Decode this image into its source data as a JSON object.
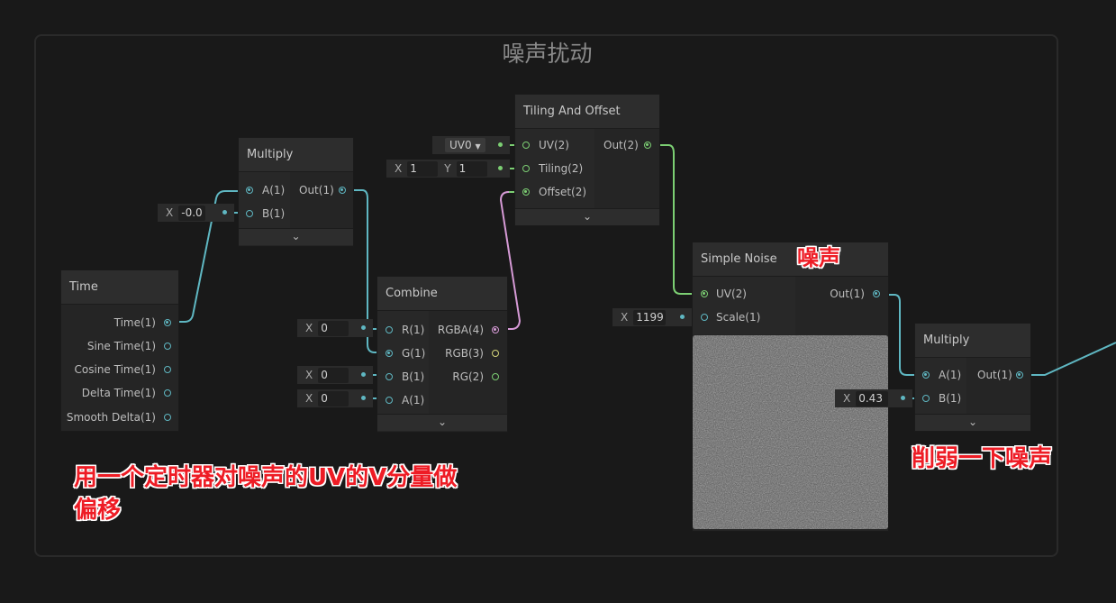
{
  "group": {
    "title": "噪声扰动"
  },
  "nodes": {
    "time": {
      "title": "Time",
      "outputs": [
        "Time(1)",
        "Sine Time(1)",
        "Cosine Time(1)",
        "Delta Time(1)",
        "Smooth Delta(1)"
      ]
    },
    "multiply1": {
      "title": "Multiply",
      "inputs": [
        "A(1)",
        "B(1)"
      ],
      "outputs": [
        "Out(1)"
      ],
      "b_field": {
        "label": "X",
        "value": "-0.0"
      }
    },
    "combine": {
      "title": "Combine",
      "inputs": [
        "R(1)",
        "G(1)",
        "B(1)",
        "A(1)"
      ],
      "outputs": [
        "RGBA(4)",
        "RGB(3)",
        "RG(2)"
      ],
      "fields": [
        {
          "label": "X",
          "value": "0"
        },
        {
          "label": "X",
          "value": "0"
        },
        {
          "label": "X",
          "value": "0"
        }
      ]
    },
    "tiling": {
      "title": "Tiling And Offset",
      "inputs": [
        "UV(2)",
        "Tiling(2)",
        "Offset(2)"
      ],
      "outputs": [
        "Out(2)"
      ],
      "uv_dropdown": "UV0",
      "tiling_field": {
        "x_label": "X",
        "x": "1",
        "y_label": "Y",
        "y": "1"
      }
    },
    "noise": {
      "title": "Simple Noise",
      "inputs": [
        "UV(2)",
        "Scale(1)"
      ],
      "outputs": [
        "Out(1)"
      ],
      "scale_field": {
        "label": "X",
        "value": "1199"
      }
    },
    "multiply2": {
      "title": "Multiply",
      "inputs": [
        "A(1)",
        "B(1)"
      ],
      "outputs": [
        "Out(1)"
      ],
      "b_field": {
        "label": "X",
        "value": "0.43"
      }
    }
  },
  "annotations": {
    "noise": "噪声",
    "timer_line1": "用一个定时器对噪声的UV的V分量做",
    "timer_line2": "偏移",
    "weaken": "削弱一下噪声"
  },
  "colors": {
    "float_wire": "#5fb7c2",
    "vec2_wire": "#7ccf73",
    "vec4_wire": "#d69ad6",
    "vec3_port": "#d3d37a",
    "annotation": "#ee1c25"
  },
  "icons": {
    "expand": "chevron-down-icon",
    "dropdown": "caret-down-icon"
  }
}
